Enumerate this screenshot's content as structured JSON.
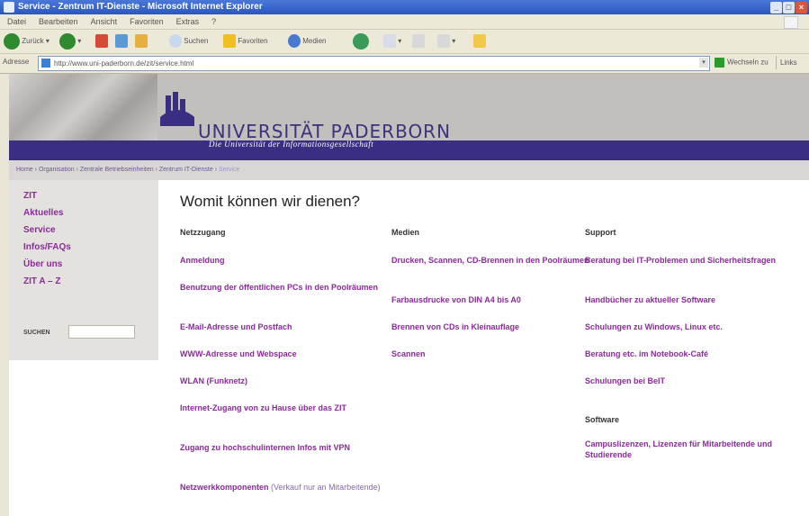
{
  "window": {
    "title": "Service - Zentrum IT-Dienste - Microsoft Internet Explorer",
    "controls": [
      "_",
      "□",
      "×"
    ]
  },
  "menu": [
    "Datei",
    "Bearbeiten",
    "Ansicht",
    "Favoriten",
    "Extras",
    "?"
  ],
  "toolbar": {
    "back_label": "Zurück",
    "search_label": "Suchen",
    "favorites_label": "Favoriten",
    "media_label": "Medien"
  },
  "address": {
    "label": "Adresse",
    "url": "http://www.uni-paderborn.de/zit/service.html",
    "go_label": "Wechseln zu",
    "links_label": "Links"
  },
  "site": {
    "name": "UNIVERSITÄT PADERBORN",
    "tagline": "Die Universität der Informationsgesellschaft",
    "breadcrumb": [
      "Home",
      "Organisation",
      "Zentrale Betriebseinheiten",
      "Zentrum IT-Dienste",
      "Service"
    ],
    "breadcrumb_separator": "›"
  },
  "sidebar": {
    "items": [
      "ZIT",
      "Aktuelles",
      "Service",
      "Infos/FAQs",
      "Über uns",
      "ZIT A – Z"
    ],
    "search_label": "SUCHEN",
    "search_value": ""
  },
  "main": {
    "title": "Womit können wir dienen?",
    "columns": [
      {
        "heading": "Netzzugang",
        "links": [
          {
            "text": "Anmeldung",
            "note": ""
          },
          {
            "text": "Benutzung der öffentlichen PCs in den Poolräumen",
            "note": ""
          },
          {
            "text": "E-Mail-Adresse und Postfach",
            "note": ""
          },
          {
            "text": "WWW-Adresse und Webspace",
            "note": ""
          },
          {
            "text": "WLAN (Funknetz)",
            "note": ""
          },
          {
            "text": "Internet-Zugang von zu Hause über das ZIT",
            "note": ""
          },
          {
            "text": "Zugang zu hochschulinternen Infos mit VPN",
            "note": ""
          },
          {
            "text": "Netzwerkkomponenten",
            "note": "(Verkauf nur an Mitarbeitende)"
          }
        ]
      },
      {
        "heading": "Medien",
        "links": [
          {
            "text": "Drucken, Scannen, CD-Brennen in den Poolräumen",
            "note": ""
          },
          {
            "text": "Farbausdrucke von DIN A4 bis A0",
            "note": ""
          },
          {
            "text": "Brennen von CDs in Kleinauflage",
            "note": ""
          },
          {
            "text": "Scannen",
            "note": ""
          }
        ]
      },
      {
        "heading": "Support",
        "links": [
          {
            "text": "Beratung bei IT-Problemen und Sicherheitsfragen",
            "note": ""
          },
          {
            "text": "Handbücher zu aktueller Software",
            "note": ""
          },
          {
            "text": "Schulungen zu Windows, Linux etc.",
            "note": ""
          },
          {
            "text": "Beratung etc. im Notebook-Café",
            "note": ""
          },
          {
            "text": "Schulungen bei BeIT",
            "note": ""
          }
        ],
        "subheading": "Software",
        "sublinks": [
          {
            "text": "Campuslizenzen, Lizenzen für Mitarbeitende und Studierende",
            "note": ""
          }
        ]
      }
    ]
  },
  "colors": {
    "link": "#8b2a9b",
    "brand": "#3a2e82",
    "header_bg": "#c2bfbc"
  }
}
